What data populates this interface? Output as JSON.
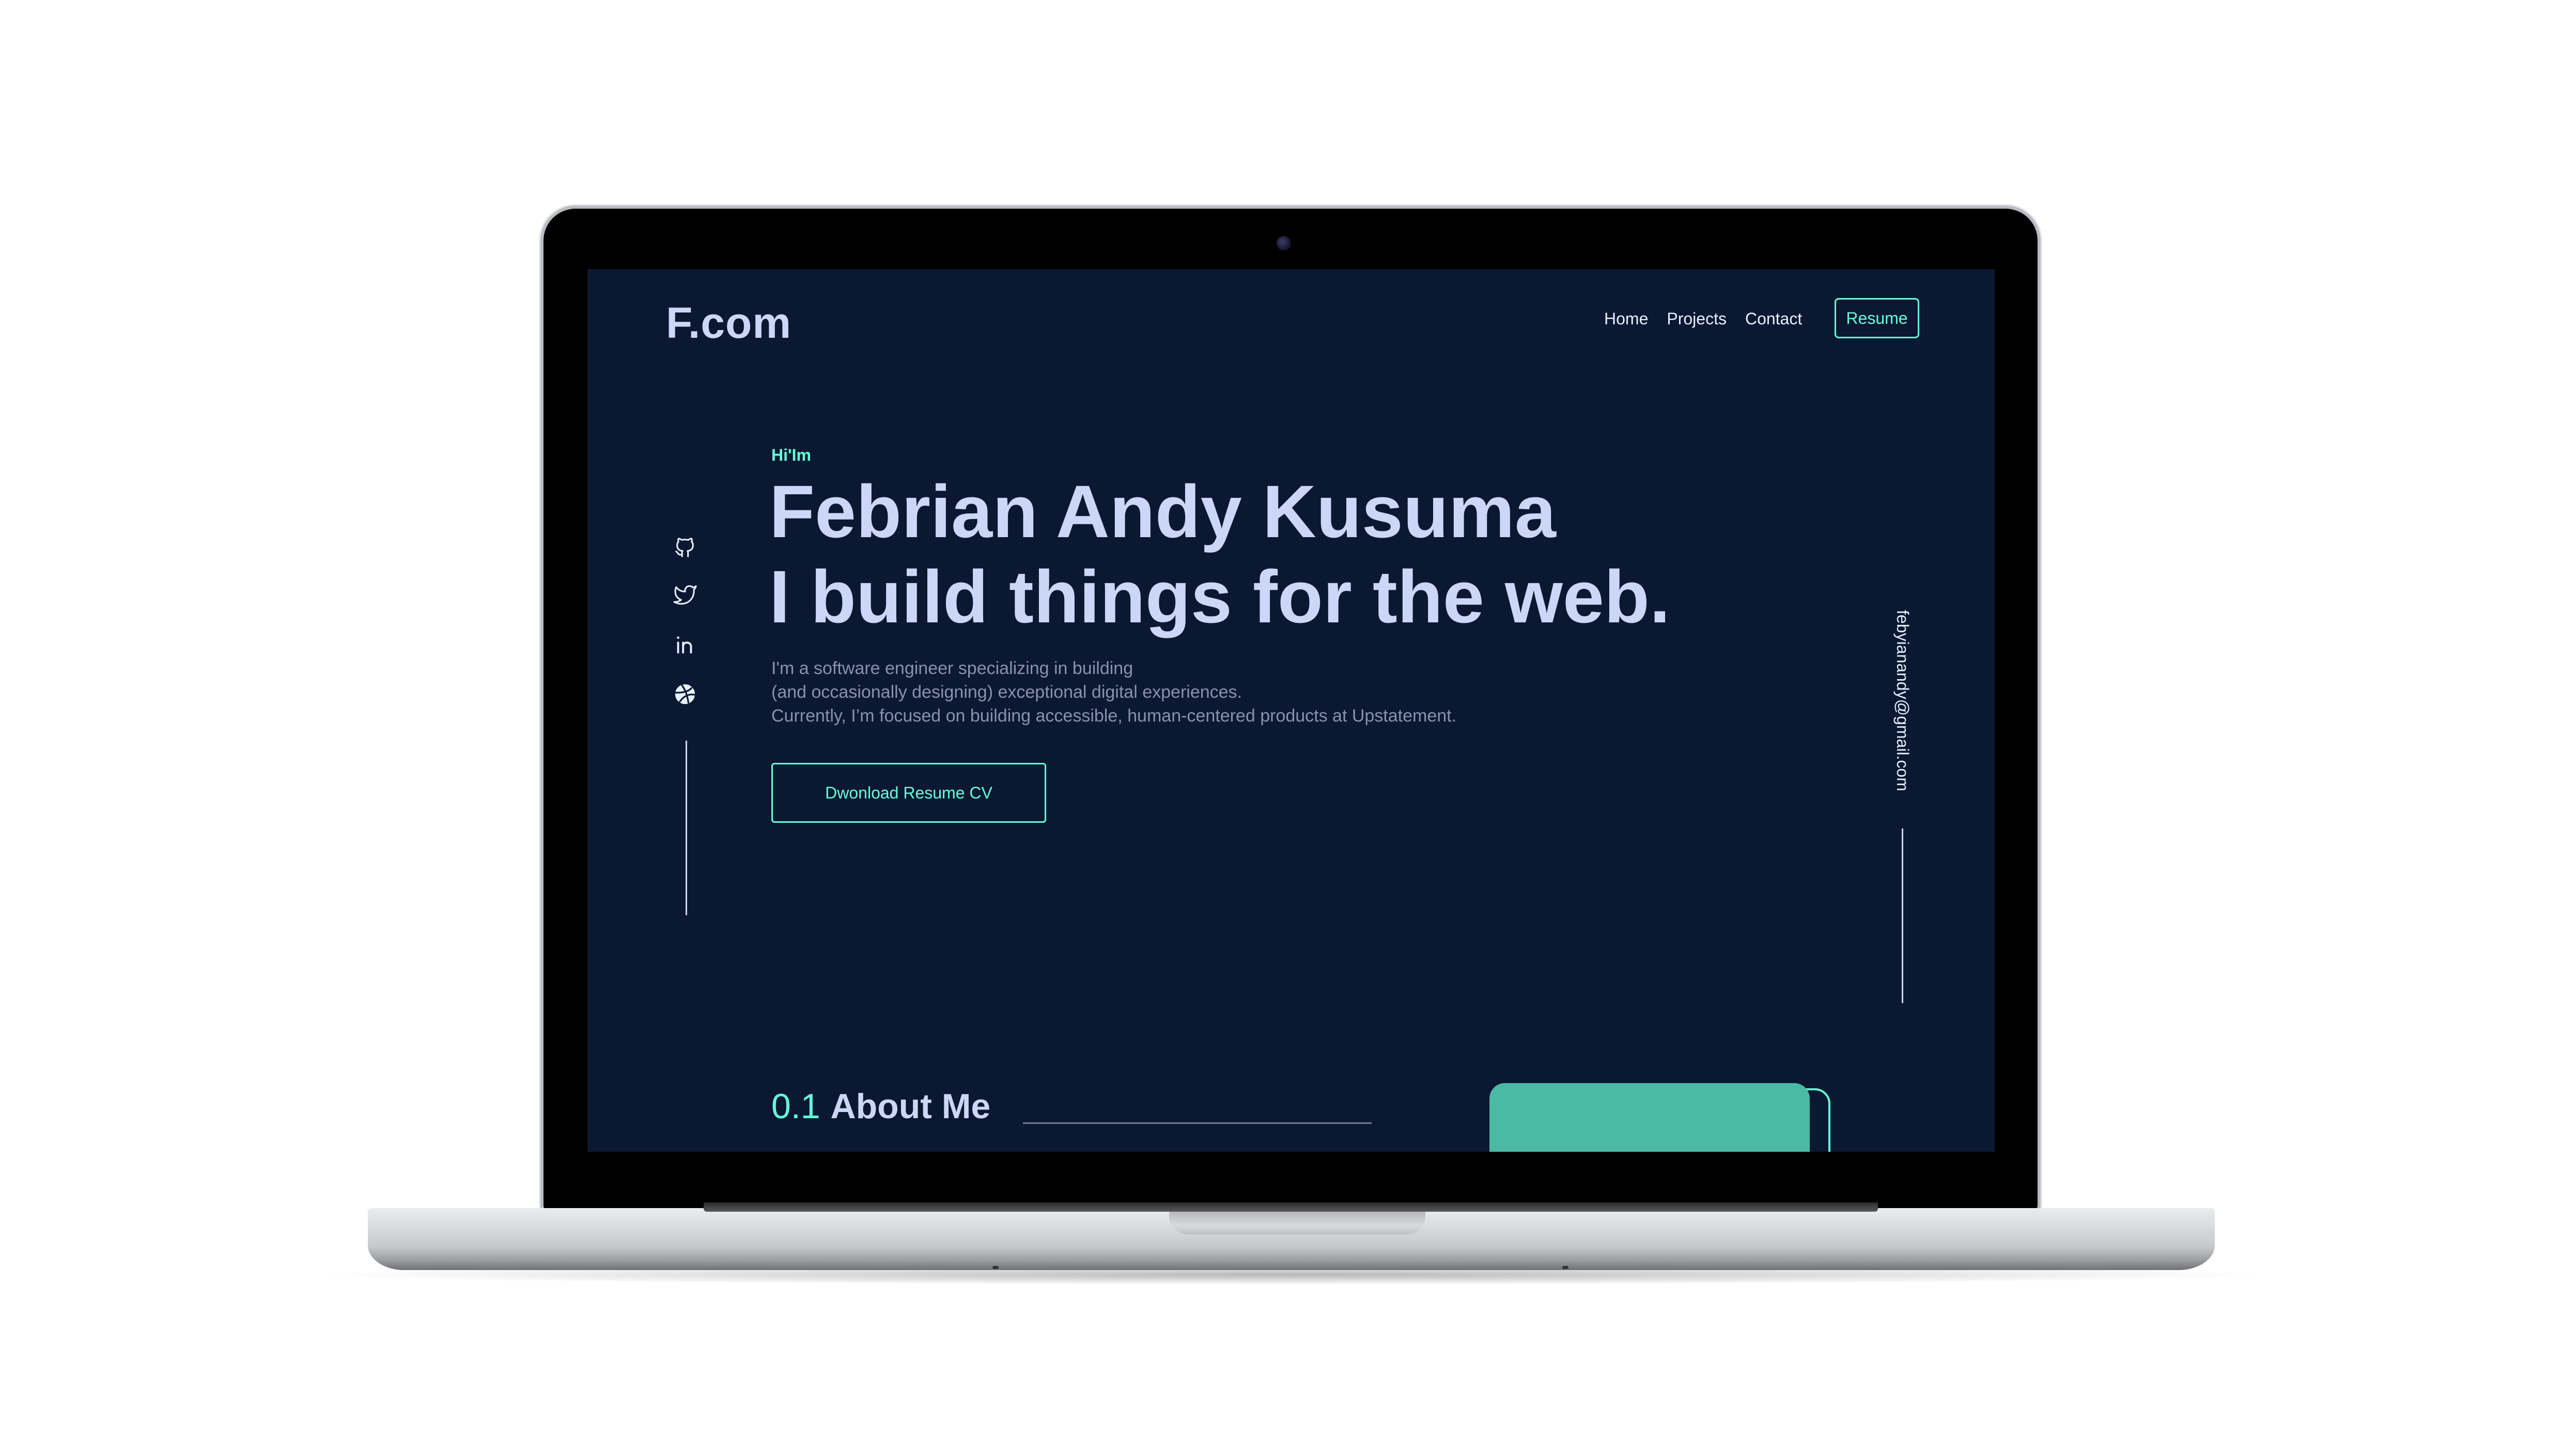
{
  "header": {
    "brand": "F.com",
    "nav": [
      "Home",
      "Projects",
      "Contact"
    ],
    "resume_label": "Resume"
  },
  "social": {
    "icons": [
      "github-icon",
      "twitter-icon",
      "linkedin-icon",
      "dribbble-icon"
    ]
  },
  "hero": {
    "greeting": "Hi'Im",
    "name": "Febrian Andy Kusuma",
    "tagline": "I build things for the web.",
    "description": [
      "I'm a software engineer specializing in building",
      "(and occasionally designing) exceptional digital experiences.",
      "Currently, I’m focused on building accessible, human-centered products at Upstatement."
    ],
    "cta_label": "Dwonload Resume CV"
  },
  "email": "febyianandy@gmail.com",
  "about": {
    "number": "0.1",
    "title": "About Me"
  },
  "colors": {
    "background": "#0b1831",
    "accent": "#64ffda",
    "heading": "#ccd6f6",
    "body_text": "#8892b0",
    "photo_card": "#4abaa5"
  }
}
